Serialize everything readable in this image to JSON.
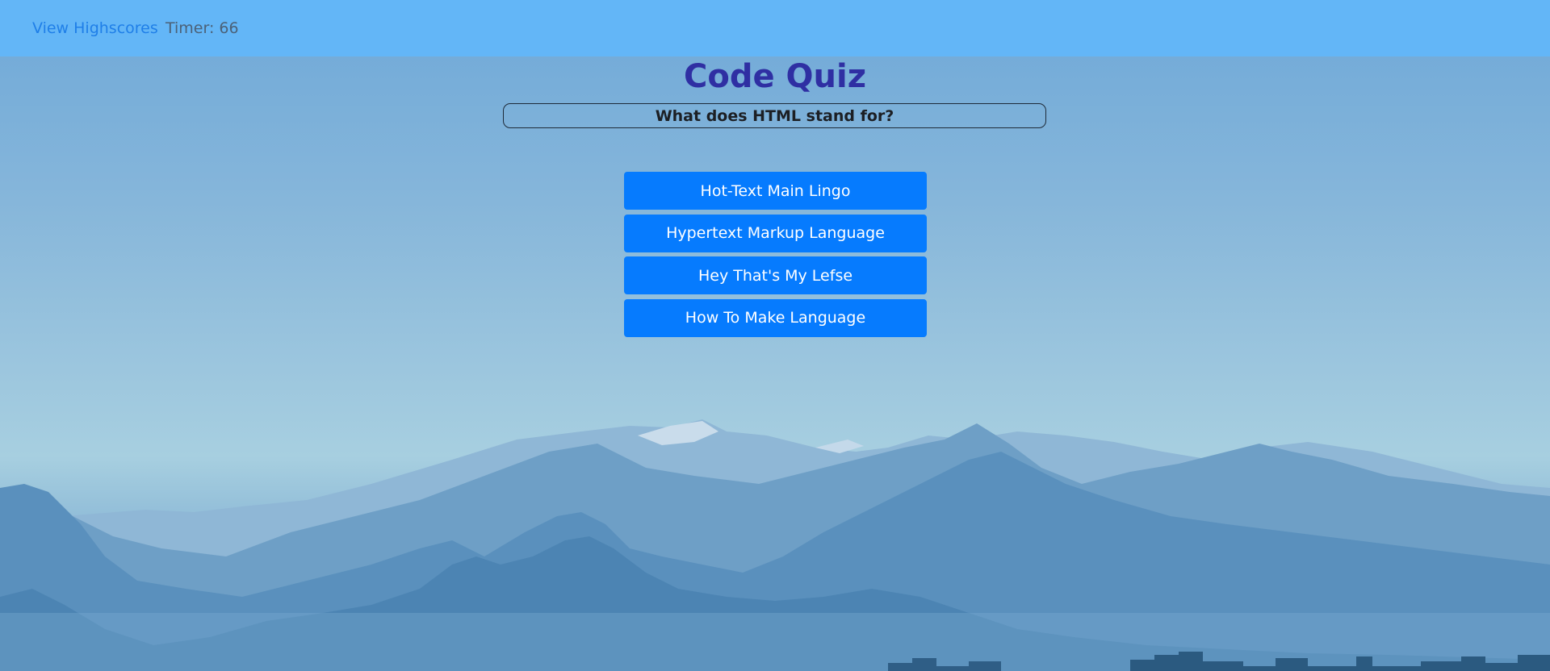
{
  "nav": {
    "highscores_label": "View Highscores",
    "timer_text": "Timer: 66"
  },
  "quiz": {
    "title": "Code Quiz",
    "question": "What does HTML stand for?",
    "answers": [
      "Hot-Text Main Lingo",
      "Hypertext Markup Language",
      "Hey That's My Lefse",
      "How To Make Language"
    ]
  },
  "colors": {
    "navbar": "#63b6f7",
    "link": "#1f7fe8",
    "title": "#2f2fa3",
    "answer_button": "#067bfe"
  }
}
